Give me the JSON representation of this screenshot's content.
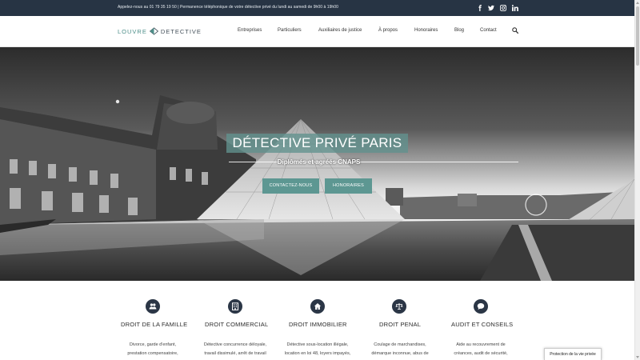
{
  "topbar": {
    "text": "Appelez-nous au 01 79 35 19 50 | Permanence téléphonique de votre détective privé du lundi au samedi de 9h00 à 19h00",
    "social": [
      "facebook-icon",
      "twitter-icon",
      "instagram-icon",
      "linkedin-icon"
    ]
  },
  "logo": {
    "part1": "LOUVRE",
    "part2": "DETECTIVE"
  },
  "nav": {
    "items": [
      "Entreprises",
      "Particuliers",
      "Auxiliaires de justice",
      "À propos",
      "Honoraires",
      "Blog",
      "Contact"
    ],
    "search_icon": "search-icon"
  },
  "hero": {
    "title": "DÉTECTIVE PRIVÉ PARIS",
    "subtitle": "Diplômés et agréés CNAPS",
    "button_contact": "CONTACTEZ-NOUS",
    "button_fees": "HONORAIRES"
  },
  "services": [
    {
      "icon": "family-icon",
      "title": "DROIT DE LA FAMILLE",
      "lines": [
        "Divorce, garde d'enfant,",
        "prestation compensatoire,"
      ]
    },
    {
      "icon": "building-icon",
      "title": "DROIT COMMERCIAL",
      "lines": [
        "Détective concurrence déloyale,",
        "travail dissimulé, arrêt de travail"
      ]
    },
    {
      "icon": "home-icon",
      "title": "DROIT IMMOBILIER",
      "lines": [
        "Détective sous-location illégale,",
        "location en loi 48, loyers impayés,"
      ]
    },
    {
      "icon": "scales-icon",
      "title": "DROIT PENAL",
      "lines": [
        "Coulage de marchandises,",
        "démarque inconnue, abus de"
      ]
    },
    {
      "icon": "chat-icon",
      "title": "AUDIT ET CONSEILS",
      "lines": [
        "Aide au recouvrement de",
        "créances, audit de sécurité,"
      ]
    }
  ],
  "privacy": {
    "label": "Protection de la vie privée"
  },
  "colors": {
    "topbar": "#273444",
    "accent": "#5d9792",
    "icon_bg": "#2b3646"
  }
}
